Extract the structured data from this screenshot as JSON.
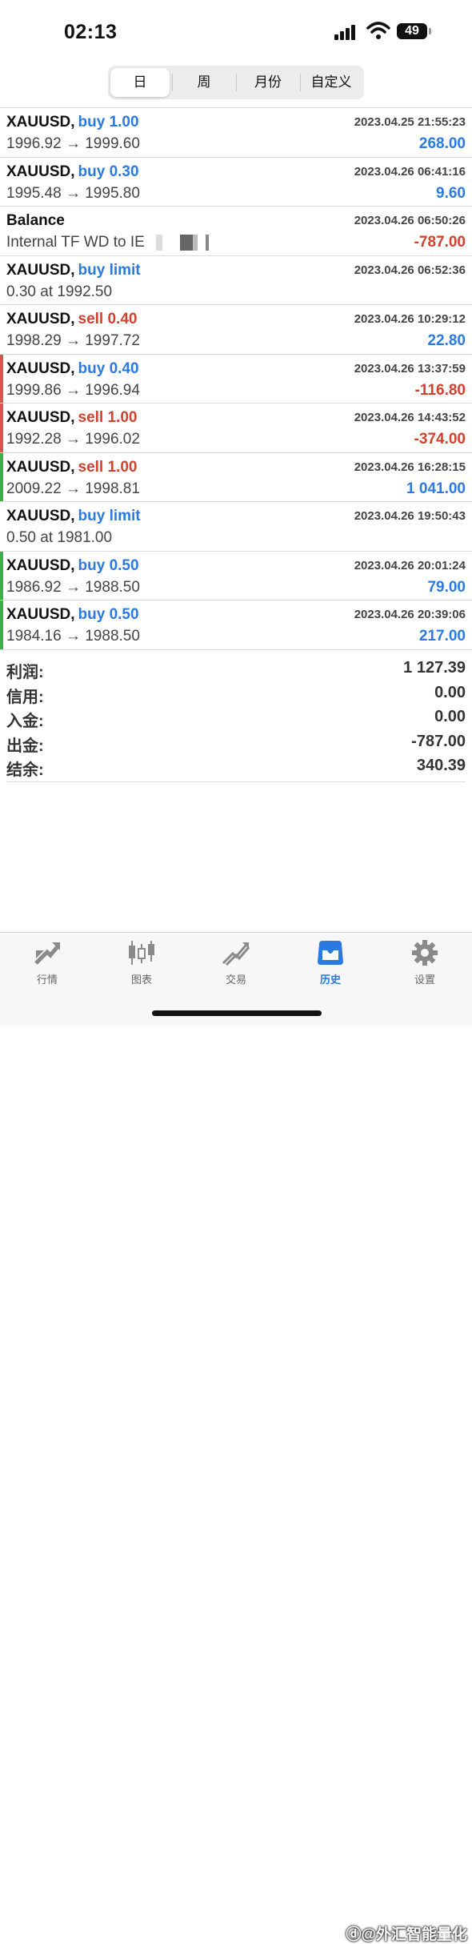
{
  "status": {
    "time": "02:13",
    "battery": "49"
  },
  "segments": [
    "日",
    "周",
    "月份",
    "自定义"
  ],
  "active_segment": 0,
  "deals": [
    {
      "symbol": "XAUUSD,",
      "action": "buy 1.00",
      "action_color": "blue",
      "date": "2023.04.25 21:55:23",
      "detail": "1996.92 → 1999.60",
      "profit": "268.00",
      "profit_color": "blue",
      "bar": ""
    },
    {
      "symbol": "XAUUSD,",
      "action": "buy 0.30",
      "action_color": "blue",
      "date": "2023.04.26 06:41:16",
      "detail": "1995.48 → 1995.80",
      "profit": "9.60",
      "profit_color": "blue",
      "bar": ""
    },
    {
      "symbol": "Balance",
      "action": "",
      "action_color": "",
      "date": "2023.04.26 06:50:26",
      "detail": "Internal TF WD to IE",
      "profit": "-787.00",
      "profit_color": "red",
      "bar": "",
      "masked": true
    },
    {
      "symbol": "XAUUSD,",
      "action": "buy limit",
      "action_color": "blue",
      "date": "2023.04.26 06:52:36",
      "detail": "0.30 at 1992.50",
      "profit": "",
      "profit_color": "",
      "bar": ""
    },
    {
      "symbol": "XAUUSD,",
      "action": "sell 0.40",
      "action_color": "red",
      "date": "2023.04.26 10:29:12",
      "detail": "1998.29 → 1997.72",
      "profit": "22.80",
      "profit_color": "blue",
      "bar": ""
    },
    {
      "symbol": "XAUUSD,",
      "action": "buy 0.40",
      "action_color": "blue",
      "date": "2023.04.26 13:37:59",
      "detail": "1999.86 → 1996.94",
      "profit": "-116.80",
      "profit_color": "red",
      "bar": "#d9534f"
    },
    {
      "symbol": "XAUUSD,",
      "action": "sell 1.00",
      "action_color": "red",
      "date": "2023.04.26 14:43:52",
      "detail": "1992.28 → 1996.02",
      "profit": "-374.00",
      "profit_color": "red",
      "bar": "#d9534f"
    },
    {
      "symbol": "XAUUSD,",
      "action": "sell 1.00",
      "action_color": "red",
      "date": "2023.04.26 16:28:15",
      "detail": "2009.22 → 1998.81",
      "profit": "1 041.00",
      "profit_color": "blue",
      "bar": "#3cb043"
    },
    {
      "symbol": "XAUUSD,",
      "action": "buy limit",
      "action_color": "blue",
      "date": "2023.04.26 19:50:43",
      "detail": "0.50 at 1981.00",
      "profit": "",
      "profit_color": "",
      "bar": ""
    },
    {
      "symbol": "XAUUSD,",
      "action": "buy 0.50",
      "action_color": "blue",
      "date": "2023.04.26 20:01:24",
      "detail": "1986.92 → 1988.50",
      "profit": "79.00",
      "profit_color": "blue",
      "bar": "#3cb043"
    },
    {
      "symbol": "XAUUSD,",
      "action": "buy 0.50",
      "action_color": "blue",
      "date": "2023.04.26 20:39:06",
      "detail": "1984.16 → 1988.50",
      "profit": "217.00",
      "profit_color": "blue",
      "bar": "#3cb043"
    }
  ],
  "summary": [
    {
      "label": "利润:",
      "value": "1 127.39"
    },
    {
      "label": "信用:",
      "value": "0.00"
    },
    {
      "label": "入金:",
      "value": "0.00"
    },
    {
      "label": "出金:",
      "value": "-787.00"
    },
    {
      "label": "结余:",
      "value": "340.39"
    }
  ],
  "tabs": [
    {
      "label": "行情",
      "icon": "quotes-icon"
    },
    {
      "label": "图表",
      "icon": "chart-icon"
    },
    {
      "label": "交易",
      "icon": "trade-icon"
    },
    {
      "label": "历史",
      "icon": "history-icon"
    },
    {
      "label": "设置",
      "icon": "settings-icon"
    }
  ],
  "active_tab": 3,
  "watermark": "外汇智能量化",
  "colors": {
    "blue": "#2a7ae2",
    "red": "#d2402e",
    "green_bar": "#3cb043",
    "red_bar": "#d9534f"
  }
}
